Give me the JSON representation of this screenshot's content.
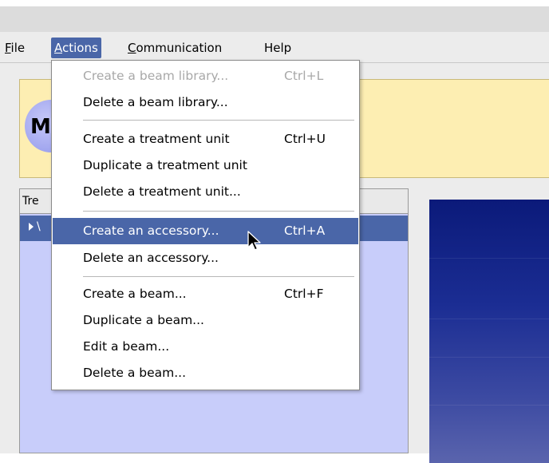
{
  "menubar": {
    "items": [
      {
        "mnemonic": "F",
        "rest": "ile"
      },
      {
        "mnemonic": "A",
        "rest": "ctions"
      },
      {
        "mnemonic": "C",
        "rest": "ommunication"
      },
      {
        "mnemonic": "",
        "rest": "Help"
      }
    ]
  },
  "banner": {
    "logo_letter": "M"
  },
  "tree": {
    "header": "Tre",
    "selected_item_fragment": "\\"
  },
  "dropdown": {
    "items": [
      {
        "label": "Create a beam library...",
        "shortcut": "Ctrl+L",
        "disabled": true
      },
      {
        "label": "Delete a beam library...",
        "shortcut": ""
      },
      {
        "label": "Create a treatment unit",
        "shortcut": "Ctrl+U"
      },
      {
        "label": "Duplicate a treatment unit",
        "shortcut": ""
      },
      {
        "label": "Delete a treatment unit...",
        "shortcut": ""
      },
      {
        "label": "Create an accessory...",
        "shortcut": "Ctrl+A",
        "highlighted": true
      },
      {
        "label": "Delete an accessory...",
        "shortcut": ""
      },
      {
        "label": "Create a beam...",
        "shortcut": "Ctrl+F"
      },
      {
        "label": "Duplicate a beam...",
        "shortcut": ""
      },
      {
        "label": "Edit a beam...",
        "shortcut": ""
      },
      {
        "label": "Delete a beam...",
        "shortcut": ""
      }
    ]
  },
  "colors": {
    "highlight": "#4a66a8",
    "banner": "#fdeeb2",
    "tree_bg": "#c8cdfa"
  }
}
